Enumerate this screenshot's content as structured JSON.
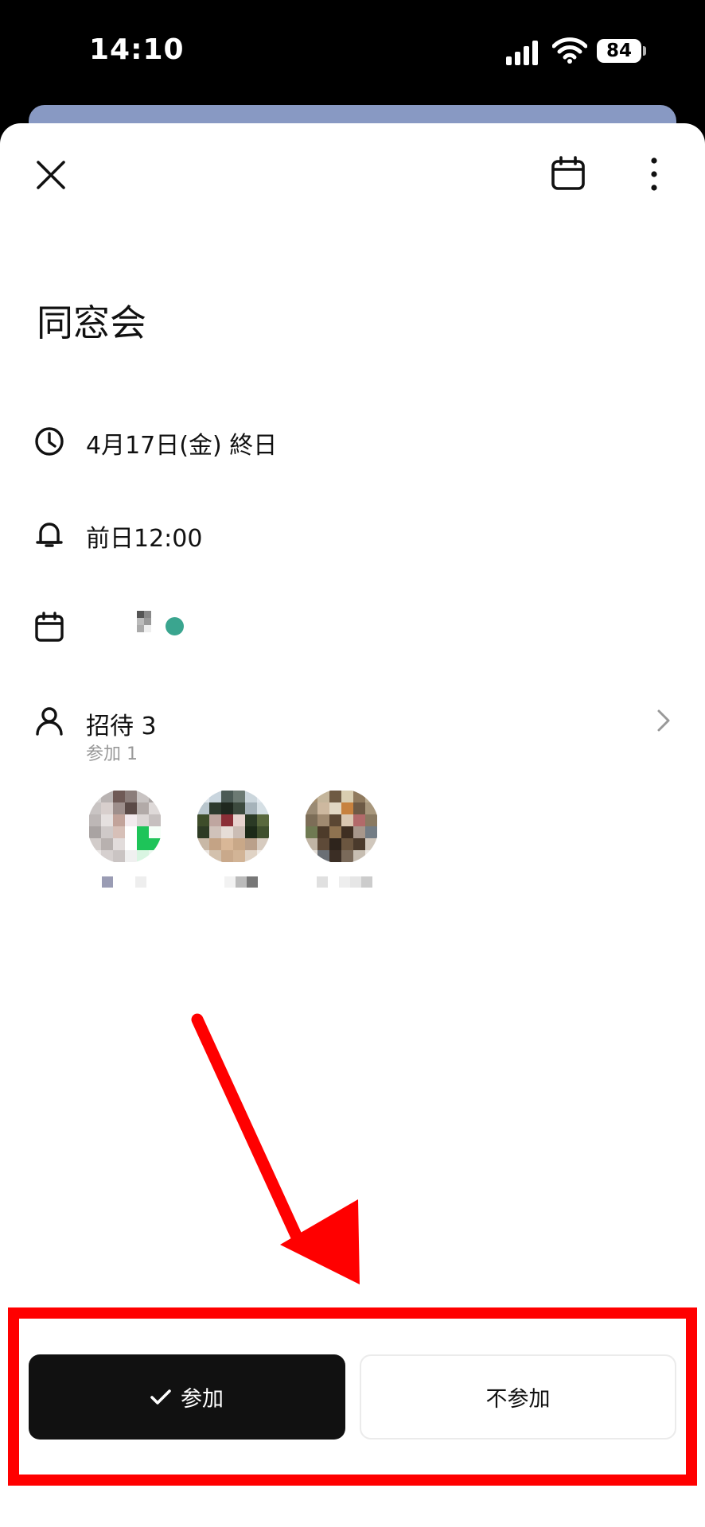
{
  "status_bar": {
    "time": "14:10",
    "battery": "84"
  },
  "header": {
    "close_icon": "close-icon",
    "calendar_icon": "calendar-icon",
    "more_icon": "more-vertical-icon"
  },
  "event": {
    "title": "同窓会",
    "datetime": "4月17日(金) 終日",
    "reminder": "前日12:00",
    "calendar_color": "#3aa58f",
    "invitees_label": "招待 3",
    "attending_label": "参加 1"
  },
  "actions": {
    "join_label": "参加",
    "decline_label": "不参加"
  },
  "colors": {
    "annotation": "#ff0000",
    "primary_button": "#111111"
  }
}
